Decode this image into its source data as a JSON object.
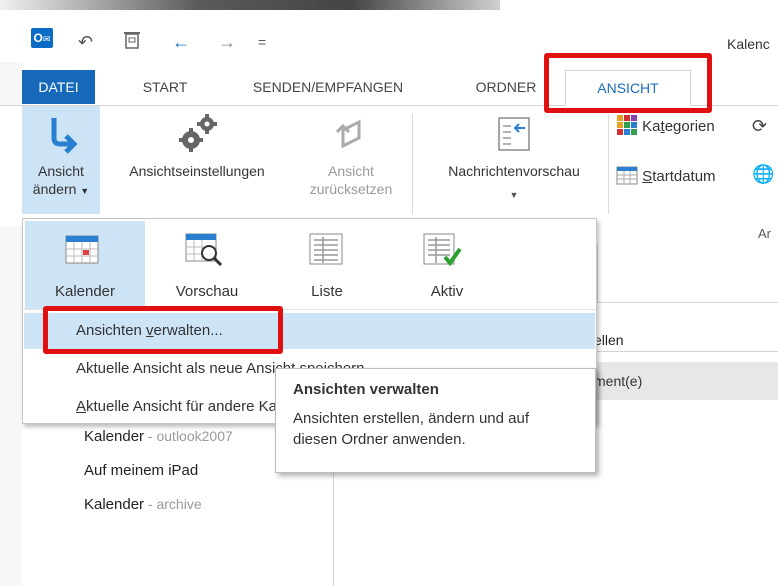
{
  "window": {
    "title": "Kalenc"
  },
  "quick_access": {
    "app_icon_label": "O",
    "customize_label": "="
  },
  "tabs": [
    {
      "id": "datei",
      "label": "DATEI"
    },
    {
      "id": "start",
      "label": "START"
    },
    {
      "id": "senden",
      "label": "SENDEN/EMPFANGEN"
    },
    {
      "id": "ordner",
      "label": "ORDNER"
    },
    {
      "id": "ansicht",
      "label": "ANSICHT"
    }
  ],
  "ribbon": {
    "ansicht_aendern": {
      "line1": "Ansicht",
      "line2": "ändern"
    },
    "ansichtseinstellungen": "Ansichtseinstellungen",
    "ansicht_zuruecksetzen": {
      "line1": "Ansicht",
      "line2": "zurücksetzen"
    },
    "nachrichtenvorschau": "Nachrichtenvorschau",
    "kategorien": {
      "prefix": "Ka",
      "underline": "t",
      "suffix": "egorien"
    },
    "startdatum": {
      "underline": "S",
      "suffix": "tartdatum"
    },
    "group_label": "Ar"
  },
  "dropdown": {
    "gallery": [
      {
        "id": "kalender",
        "label": "Kalender",
        "selected": true
      },
      {
        "id": "vorschau",
        "label": "Vorschau",
        "selected": false
      },
      {
        "id": "liste",
        "label": "Liste",
        "selected": false
      },
      {
        "id": "aktiv",
        "label": "Aktiv",
        "selected": false
      }
    ],
    "menu": {
      "verwalten": {
        "prefix": "Ansichten ",
        "underline": "v",
        "suffix": "erwalten..."
      },
      "speichern": "Aktuelle Ansicht als neue Ansicht speichern",
      "anwenden": {
        "underline": "A",
        "suffix": "ktuelle Ansicht für andere Kalenderordner übernehmen"
      }
    }
  },
  "tooltip": {
    "title": "Ansichten verwalten",
    "text": "Ansichten erstellen, ändern und auf diesen Ordner anwenden."
  },
  "content": {
    "column_header": "ellen",
    "row_text": "ment(e)"
  },
  "folders": [
    {
      "name": "Kalender",
      "sub": " - outlook2007"
    },
    {
      "name": "Auf meinem iPad",
      "sub": ""
    },
    {
      "name": "Kalender",
      "sub": " - archive"
    }
  ],
  "colors": {
    "accent": "#1669b8",
    "highlight": "#cde3f6",
    "annotation": "#e01010"
  }
}
